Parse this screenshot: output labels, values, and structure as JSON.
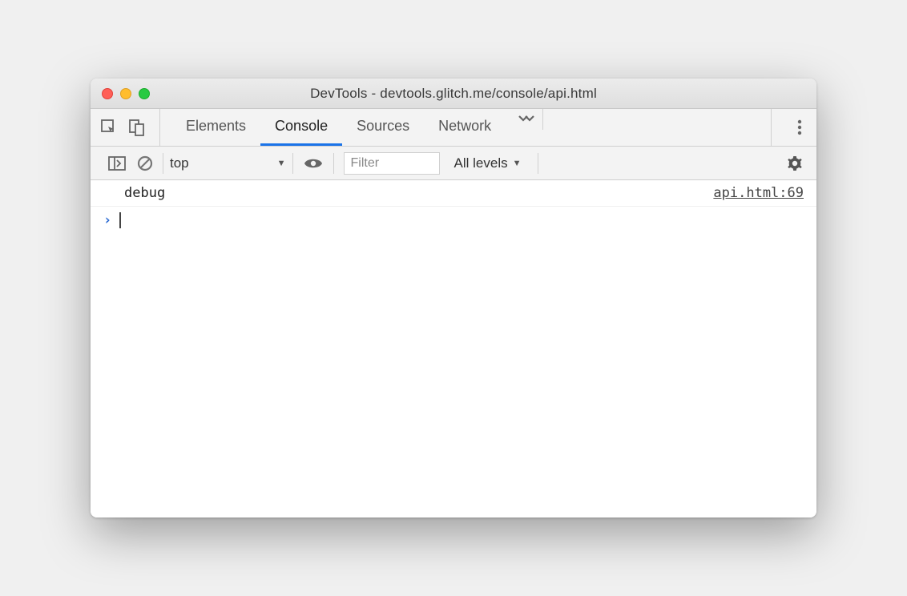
{
  "window": {
    "title": "DevTools - devtools.glitch.me/console/api.html"
  },
  "tabs": {
    "items": [
      {
        "label": "Elements",
        "active": false
      },
      {
        "label": "Console",
        "active": true
      },
      {
        "label": "Sources",
        "active": false
      },
      {
        "label": "Network",
        "active": false
      }
    ]
  },
  "toolbar": {
    "context": "top",
    "filter_placeholder": "Filter",
    "levels_label": "All levels"
  },
  "console": {
    "rows": [
      {
        "text": "debug",
        "source": "api.html:69"
      }
    ]
  }
}
